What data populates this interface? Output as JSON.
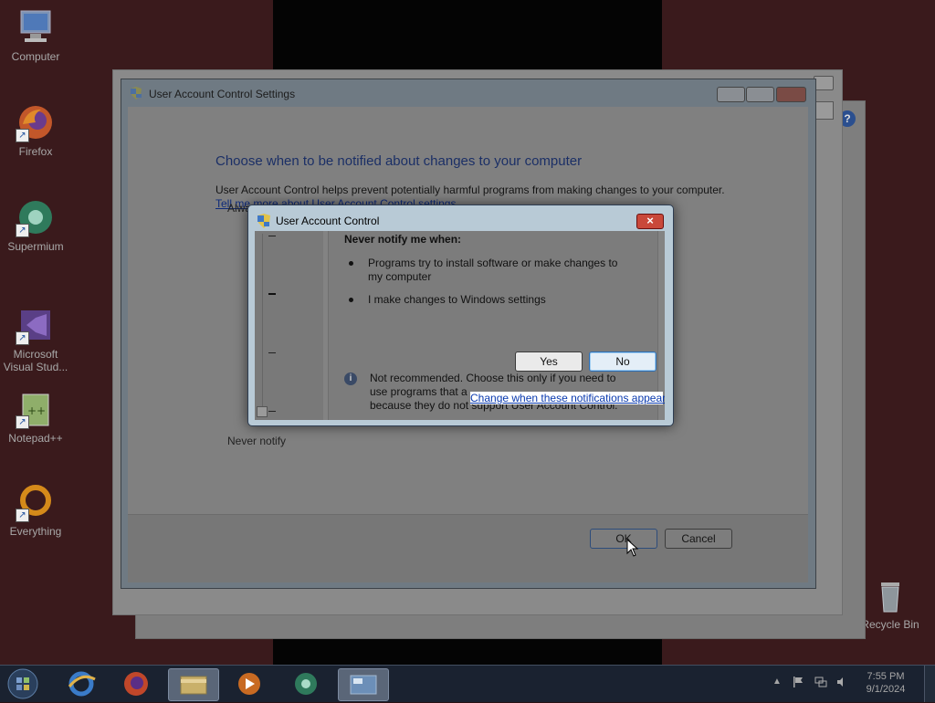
{
  "desktop": {
    "icons": [
      {
        "label": "Computer",
        "icon": "computer-icon"
      },
      {
        "label": "Firefox",
        "icon": "firefox-icon"
      },
      {
        "label": "Supermium",
        "icon": "supermium-icon"
      },
      {
        "label": "Microsoft Visual Stud...",
        "icon": "visual-studio-icon"
      },
      {
        "label": "Notepad++",
        "icon": "notepad-plus-plus-icon"
      },
      {
        "label": "Everything",
        "icon": "everything-icon"
      }
    ],
    "recycle_bin": "Recycle Bin"
  },
  "uac_settings": {
    "title": "User Account Control Settings",
    "heading": "Choose when to be notified about changes to your computer",
    "description": "User Account Control helps prevent potentially harmful programs from making changes to your computer.",
    "link": "Tell me more about User Account Control settings",
    "slider_top_label": "Alwa",
    "slider_bottom_label": "Never notify",
    "ok_label": "OK",
    "cancel_label": "Cancel"
  },
  "uac_dialog": {
    "title": "User Account Control",
    "heading": "Never notify me when:",
    "bullets": [
      "Programs try to install software or make changes to my computer",
      "I make changes to Windows settings"
    ],
    "yes_label": "Yes",
    "no_label": "No",
    "note_line1": "Not recommended. Choose this only if you need to",
    "note_line2": "use programs that a",
    "note_line3": "because they do not support User Account Control.",
    "tooltip_link": "Change when these notifications appear"
  },
  "taskbar": {
    "apps": [
      "internet-explorer-icon",
      "firefox-icon",
      "file-explorer-icon",
      "media-player-icon",
      "supermium-icon",
      "uac-settings-icon"
    ],
    "time": "7:55 PM",
    "date": "9/1/2024"
  },
  "colors": {
    "title_blue": "#1b2f66",
    "link_blue": "#0b3bb0",
    "close_red": "#c9483a"
  }
}
